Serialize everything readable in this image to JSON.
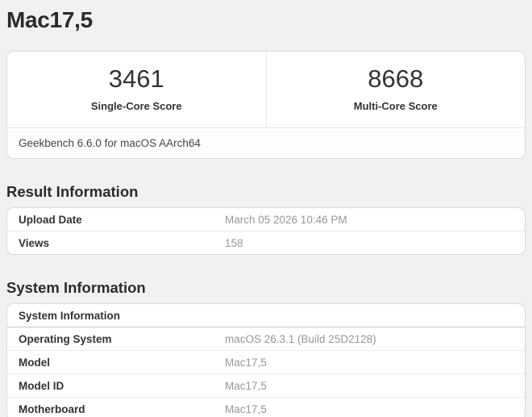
{
  "page": {
    "title": "Mac17,5"
  },
  "score_card": {
    "scores": [
      {
        "value": "3461",
        "label": "Single-Core Score"
      },
      {
        "value": "8668",
        "label": "Multi-Core Score"
      }
    ],
    "footer": "Geekbench 6.6.0 for macOS AArch64"
  },
  "result_information": {
    "heading": "Result Information",
    "rows": [
      {
        "label": "Upload Date",
        "value": "March 05 2026 10:46 PM"
      },
      {
        "label": "Views",
        "value": "158"
      }
    ]
  },
  "system_information": {
    "heading": "System Information",
    "table_header": "System Information",
    "rows": [
      {
        "label": "Operating System",
        "value": "macOS 26.3.1 (Build 25D2128)"
      },
      {
        "label": "Model",
        "value": "Mac17,5"
      },
      {
        "label": "Model ID",
        "value": "Mac17,5"
      },
      {
        "label": "Motherboard",
        "value": "Mac17,5"
      }
    ]
  },
  "colors": {
    "page_background": "#f1f1f2",
    "card_background": "#ffffff",
    "card_border": "#dadade",
    "value_text": "#97979c",
    "label_text": "#333336"
  }
}
